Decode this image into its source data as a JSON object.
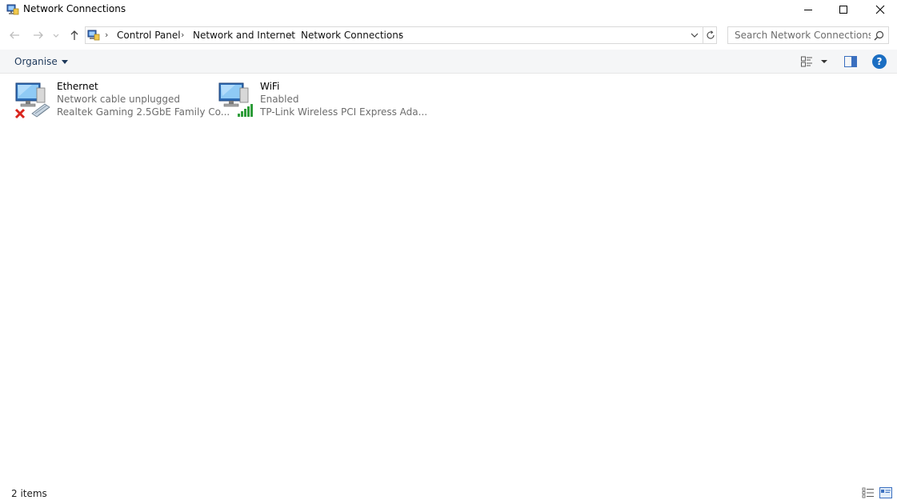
{
  "window": {
    "title": "Network Connections"
  },
  "address": {
    "breadcrumbs": [
      "Control Panel",
      "Network and Internet",
      "Network Connections"
    ]
  },
  "search": {
    "placeholder": "Search Network Connections"
  },
  "toolbar": {
    "organise_label": "Organise",
    "help_label": "?"
  },
  "connections": [
    {
      "name": "Ethernet",
      "status": "Network cable unplugged",
      "device": "Realtek Gaming 2.5GbE Family Co...",
      "icon": "ethernet-disconnected-icon"
    },
    {
      "name": "WiFi",
      "status": "Enabled",
      "device": "TP-Link Wireless PCI Express Ada...",
      "icon": "wifi-signal-icon"
    }
  ],
  "statusbar": {
    "count": "2 items"
  },
  "colors": {
    "accent": "#1b6ec2",
    "error": "#d9251d",
    "signal": "#2e9d3a"
  }
}
